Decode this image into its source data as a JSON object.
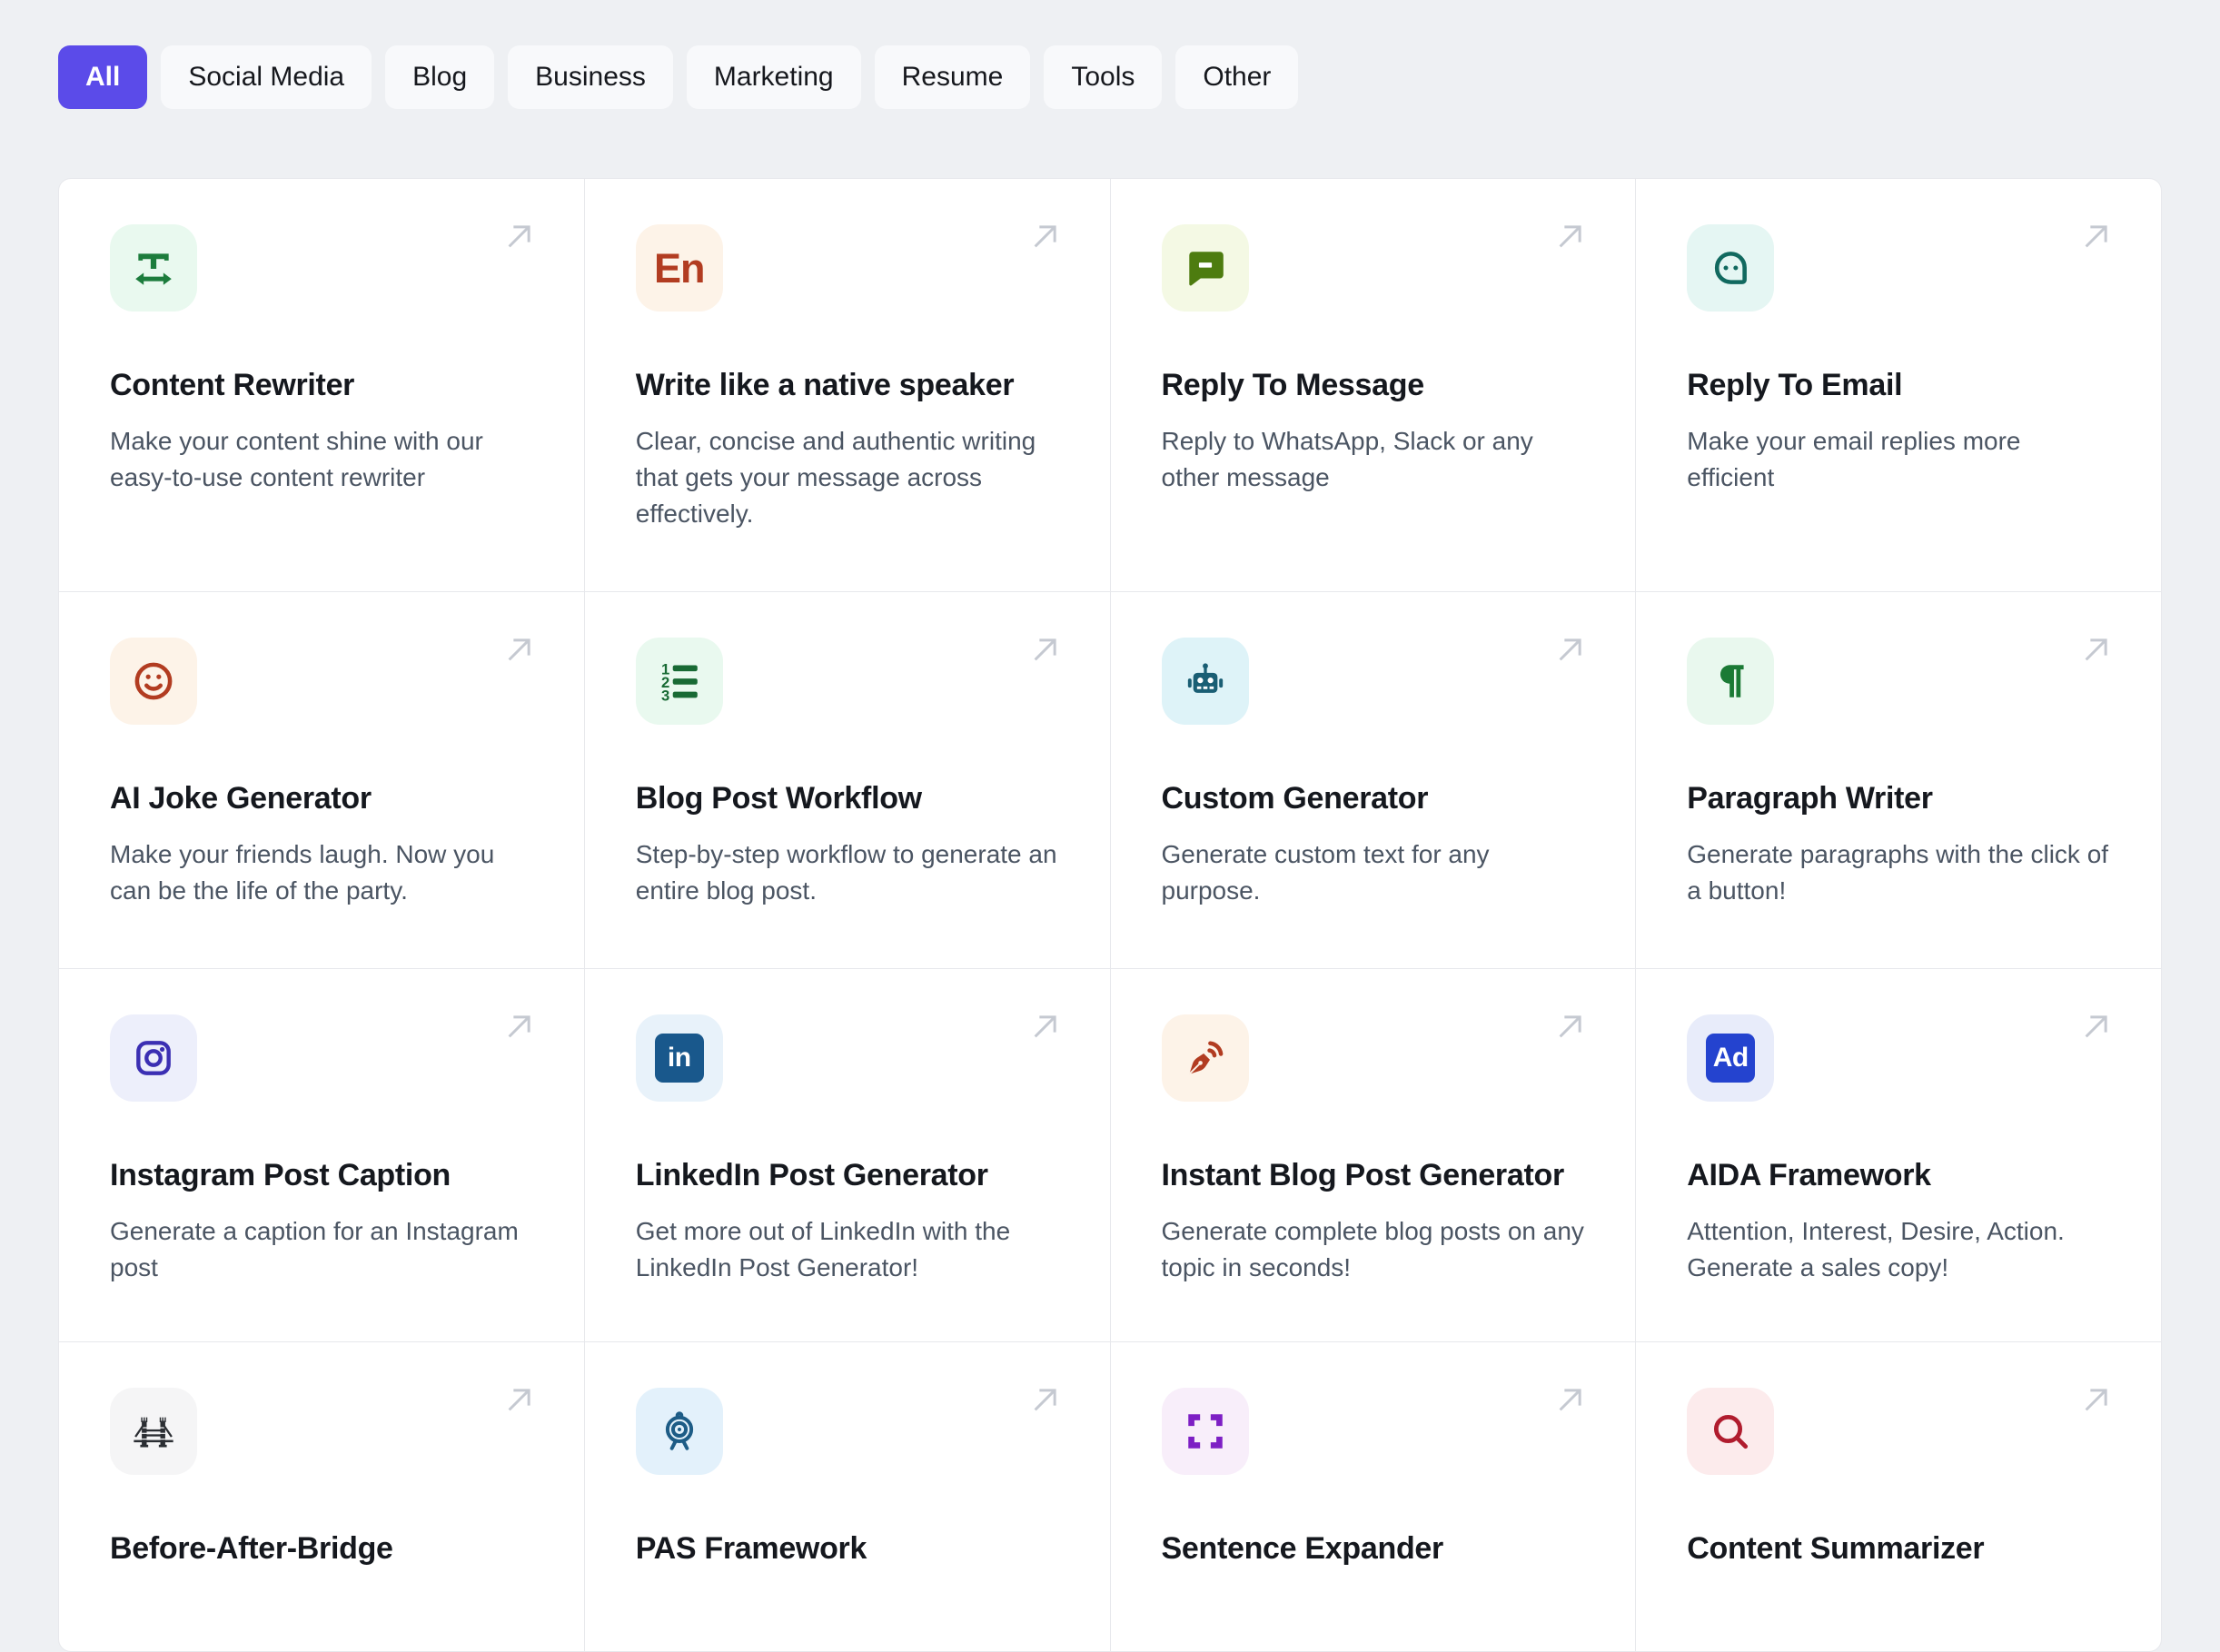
{
  "page": {
    "background_color": "#eef0f3",
    "card_background": "#ffffff",
    "grid_border_color": "#e7e8ec",
    "arrow_color": "#c5c9d1",
    "title_color": "#15181e",
    "description_color": "#4b5563"
  },
  "filter_bar": {
    "active_color": "#5b4be9",
    "items": [
      {
        "label": "All",
        "active": true
      },
      {
        "label": "Social Media",
        "active": false
      },
      {
        "label": "Blog",
        "active": false
      },
      {
        "label": "Business",
        "active": false
      },
      {
        "label": "Marketing",
        "active": false
      },
      {
        "label": "Resume",
        "active": false
      },
      {
        "label": "Tools",
        "active": false
      },
      {
        "label": "Other",
        "active": false
      }
    ]
  },
  "card_action": {
    "icon": "arrow-up-right-icon"
  },
  "cards": [
    {
      "title": "Content Rewriter",
      "description": "Make your content shine with our easy-to-use content rewriter",
      "icon": "text-width-icon",
      "icon_bg": "#e9f9ef",
      "icon_color": "#1c7c3c"
    },
    {
      "title": "Write like a native speaker",
      "description": "Clear, concise and authentic writing that gets your message across effectively.",
      "icon": "english-letters-icon",
      "icon_text": "En",
      "icon_bg": "#fdf3e8",
      "icon_color": "#b23c21"
    },
    {
      "title": "Reply To Message",
      "description": "Reply to WhatsApp, Slack or any other message",
      "icon": "chat-bubble-icon",
      "icon_bg": "#f4f9e4",
      "icon_color": "#4d7c0f"
    },
    {
      "title": "Reply To Email",
      "description": "Make your email replies more efficient",
      "icon": "message-face-icon",
      "icon_bg": "#e5f6f3",
      "icon_color": "#11695f"
    },
    {
      "title": "AI Joke Generator",
      "description": "Make your friends laugh. Now you can be the life of the party.",
      "icon": "smiley-icon",
      "icon_bg": "#fdf3e8",
      "icon_color": "#b23c21"
    },
    {
      "title": "Blog Post Workflow",
      "description": "Step-by-step workflow to generate an entire blog post.",
      "icon": "numbered-list-icon",
      "icon_bg": "#e9f9ef",
      "icon_color": "#186a34"
    },
    {
      "title": "Custom Generator",
      "description": "Generate custom text for any purpose.",
      "icon": "robot-icon",
      "icon_bg": "#def3f8",
      "icon_color": "#1a5e74"
    },
    {
      "title": "Paragraph Writer",
      "description": "Generate paragraphs with the click of a button!",
      "icon": "pilcrow-icon",
      "icon_bg": "#e9f8ee",
      "icon_color": "#1b7a35"
    },
    {
      "title": "Instagram Post Caption",
      "description": "Generate a caption for an Instagram post",
      "icon": "instagram-icon",
      "icon_bg": "#edeffb",
      "icon_color": "#3b2fb3"
    },
    {
      "title": "LinkedIn Post Generator",
      "description": "Get more out of LinkedIn with the LinkedIn Post Generator!",
      "icon": "linkedin-icon",
      "icon_text": "in",
      "icon_bg": "#e8f2fa",
      "icon_color": "#19588c"
    },
    {
      "title": "Instant Blog Post Generator",
      "description": "Generate complete blog posts on any topic in seconds!",
      "icon": "pen-rss-icon",
      "icon_bg": "#fdf3e8",
      "icon_color": "#b23c21"
    },
    {
      "title": "AIDA Framework",
      "description": "Attention, Interest, Desire, Action. Generate a sales copy!",
      "icon": "ad-badge-icon",
      "icon_text": "Ad",
      "icon_bg": "#e8ecfa",
      "icon_color": "#2443cf"
    },
    {
      "title": "Before-After-Bridge",
      "description": "",
      "icon": "bridge-icon",
      "icon_bg": "#f5f5f6",
      "icon_color": "#2b2e33"
    },
    {
      "title": "PAS Framework",
      "description": "",
      "icon": "target-icon",
      "icon_bg": "#e3f1fb",
      "icon_color": "#1d5c86"
    },
    {
      "title": "Sentence Expander",
      "description": "",
      "icon": "expand-icon",
      "icon_bg": "#f8eefa",
      "icon_color": "#7d1fc4"
    },
    {
      "title": "Content Summarizer",
      "description": "",
      "icon": "magnifier-icon",
      "icon_bg": "#fcebec",
      "icon_color": "#b01c2e"
    }
  ]
}
